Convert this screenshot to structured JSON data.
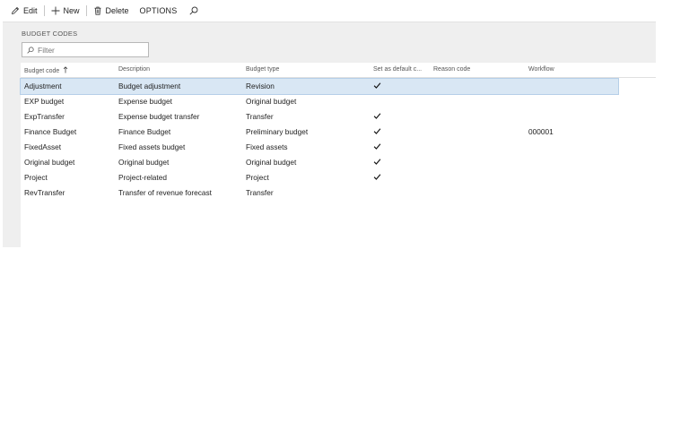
{
  "toolbar": {
    "edit_label": "Edit",
    "new_label": "New",
    "delete_label": "Delete",
    "options_label": "OPTIONS"
  },
  "section": {
    "title": "BUDGET CODES"
  },
  "filter": {
    "placeholder": "Filter",
    "value": ""
  },
  "grid": {
    "headers": {
      "code": "Budget code",
      "description": "Description",
      "type": "Budget type",
      "default": "Set as default c...",
      "reason": "Reason code",
      "workflow": "Workflow"
    },
    "rows": [
      {
        "code": "Adjustment",
        "description": "Budget adjustment",
        "type": "Revision",
        "default": true,
        "reason": "",
        "workflow": "",
        "selected": true
      },
      {
        "code": "EXP budget",
        "description": "Expense budget",
        "type": "Original budget",
        "default": false,
        "reason": "",
        "workflow": ""
      },
      {
        "code": "ExpTransfer",
        "description": "Expense budget transfer",
        "type": "Transfer",
        "default": true,
        "reason": "",
        "workflow": ""
      },
      {
        "code": "Finance Budget",
        "description": "Finance Budget",
        "type": "Preliminary budget",
        "default": true,
        "reason": "",
        "workflow": "000001"
      },
      {
        "code": "FixedAsset",
        "description": "Fixed assets budget",
        "type": "Fixed assets",
        "default": true,
        "reason": "",
        "workflow": ""
      },
      {
        "code": "Original budget",
        "description": "Original budget",
        "type": "Original budget",
        "default": true,
        "reason": "",
        "workflow": ""
      },
      {
        "code": "Project",
        "description": "Project-related",
        "type": "Project",
        "default": true,
        "reason": "",
        "workflow": ""
      },
      {
        "code": "RevTransfer",
        "description": "Transfer of revenue forecast",
        "type": "Transfer",
        "default": false,
        "reason": "",
        "workflow": ""
      }
    ]
  }
}
